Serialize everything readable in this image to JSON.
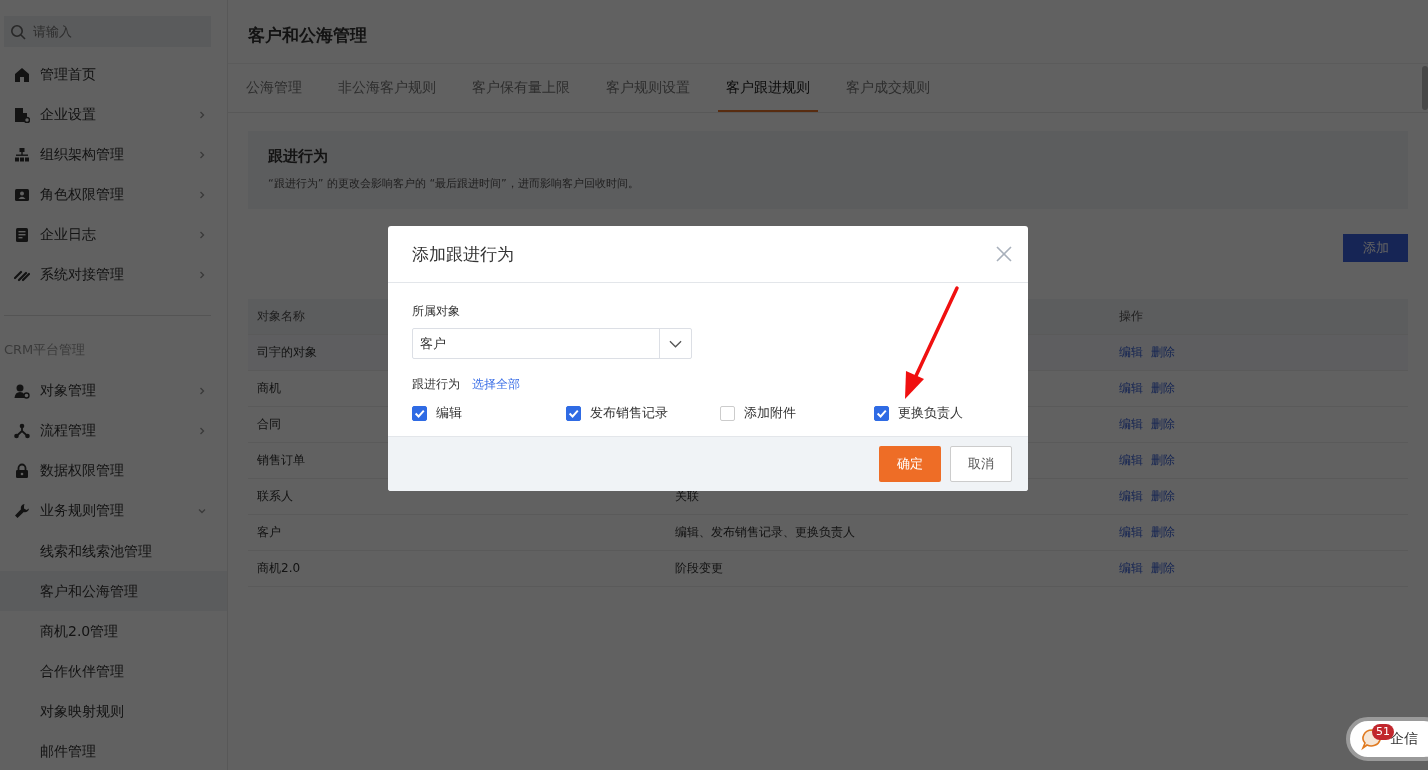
{
  "search": {
    "placeholder": "请输入"
  },
  "sidebar": {
    "items": [
      {
        "label": "管理首页",
        "kind": "link"
      },
      {
        "label": "企业设置",
        "kind": "group",
        "expanded": false
      },
      {
        "label": "组织架构管理",
        "kind": "group",
        "expanded": false
      },
      {
        "label": "角色权限管理",
        "kind": "group",
        "expanded": false
      },
      {
        "label": "企业日志",
        "kind": "group",
        "expanded": false
      },
      {
        "label": "系统对接管理",
        "kind": "group",
        "expanded": false
      }
    ],
    "section_title": "CRM平台管理",
    "section_items": [
      {
        "label": "对象管理",
        "kind": "group",
        "expanded": false
      },
      {
        "label": "流程管理",
        "kind": "group",
        "expanded": false
      },
      {
        "label": "数据权限管理",
        "kind": "link"
      },
      {
        "label": "业务规则管理",
        "kind": "group",
        "expanded": true,
        "children": [
          {
            "label": "线索和线索池管理",
            "selected": false
          },
          {
            "label": "客户和公海管理",
            "selected": true
          },
          {
            "label": "商机2.0管理",
            "selected": false
          },
          {
            "label": "合作伙伴管理",
            "selected": false
          },
          {
            "label": "对象映射规则",
            "selected": false
          },
          {
            "label": "邮件管理",
            "selected": false
          }
        ]
      }
    ]
  },
  "page_title": "客户和公海管理",
  "tabs": [
    {
      "label": "公海管理",
      "selected": false
    },
    {
      "label": "非公海客户规则",
      "selected": false
    },
    {
      "label": "客户保有量上限",
      "selected": false
    },
    {
      "label": "客户规则设置",
      "selected": false
    },
    {
      "label": "客户跟进规则",
      "selected": true
    },
    {
      "label": "客户成交规则",
      "selected": false
    }
  ],
  "notice": {
    "title": "跟进行为",
    "text": "“跟进行为” 的更改会影响客户的 “最后跟进时间”，进而影响客户回收时间。"
  },
  "add_button": "添加",
  "table": {
    "columns": {
      "name": "对象名称",
      "actions": "操作"
    },
    "rows": [
      {
        "name": "司宇的对象",
        "actions": [
          "编辑",
          "删除"
        ]
      },
      {
        "name": "商机",
        "actions": [
          "编辑",
          "删除"
        ]
      },
      {
        "name": "合同",
        "actions": [
          "编辑",
          "删除"
        ]
      },
      {
        "name": "销售订单",
        "actions": [
          "编辑",
          "删除"
        ]
      },
      {
        "name": "联系人",
        "column_2": "关联",
        "actions": [
          "编辑",
          "删除"
        ]
      },
      {
        "name": "客户",
        "column_2": "编辑、发布销售记录、更换负责人",
        "actions": [
          "编辑",
          "删除"
        ]
      },
      {
        "name": "商机2.0",
        "column_2": "阶段变更",
        "actions": [
          "编辑",
          "删除"
        ]
      }
    ]
  },
  "dialog": {
    "title": "添加跟进行为",
    "object_label": "所属对象",
    "object_value": "客户",
    "behavior_label": "跟进行为",
    "select_all": "选择全部",
    "options": [
      {
        "label": "编辑",
        "checked": true
      },
      {
        "label": "发布销售记录",
        "checked": true
      },
      {
        "label": "添加附件",
        "checked": false
      },
      {
        "label": "更换负责人",
        "checked": true
      }
    ],
    "confirm": "确定",
    "cancel": "取消"
  },
  "chat": {
    "badge": "51",
    "label": "企信"
  }
}
